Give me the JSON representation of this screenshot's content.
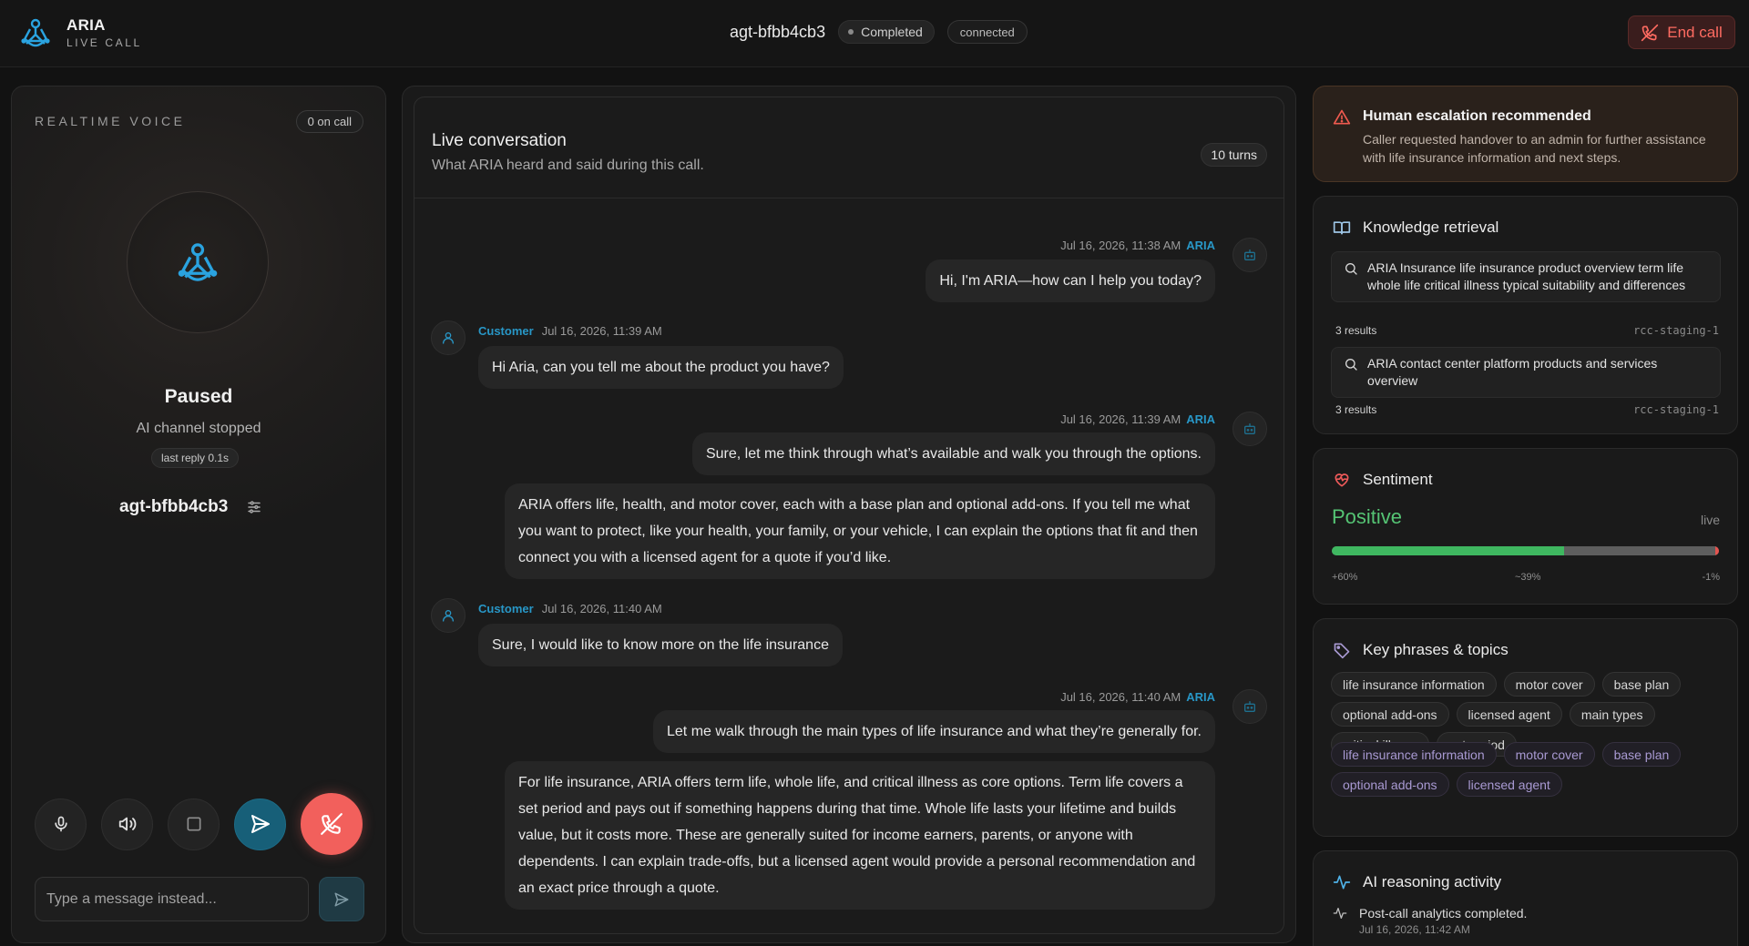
{
  "header": {
    "brand_name": "ARIA",
    "brand_sub": "LIVE CALL",
    "agent_id": "agt-bfbb4cb3",
    "status": "Completed",
    "connection": "connected",
    "end_call_label": "End call"
  },
  "voice": {
    "section_label": "REALTIME VOICE",
    "on_call": "0 on call",
    "state": "Paused",
    "state_detail": "AI channel stopped",
    "last_reply": "last reply 0.1s",
    "agent_id": "agt-bfbb4cb3",
    "input_placeholder": "Type a message instead..."
  },
  "conversation": {
    "title": "Live conversation",
    "subtitle": "What ARIA heard and said during this call.",
    "turns": "10 turns",
    "messages": [
      {
        "who": "ARIA",
        "time": "Jul 16, 2026, 11:38 AM",
        "bubbles": [
          "Hi, I'm ARIA—how can I help you today?"
        ]
      },
      {
        "who": "Customer",
        "time": "Jul 16, 2026, 11:39 AM",
        "bubbles": [
          "Hi Aria, can you tell me about the product you have?"
        ]
      },
      {
        "who": "ARIA",
        "time": "Jul 16, 2026, 11:39 AM",
        "bubbles": [
          "Sure, let me think through what’s available and walk you through the options.",
          "ARIA offers life, health, and motor cover, each with a base plan and optional add-ons. If you tell me what you want to protect, like your health, your family, or your vehicle, I can explain the options that fit and then connect you with a licensed agent for a quote if you’d like."
        ]
      },
      {
        "who": "Customer",
        "time": "Jul 16, 2026, 11:40 AM",
        "bubbles": [
          "Sure, I would like to know more on the life insurance"
        ]
      },
      {
        "who": "ARIA",
        "time": "Jul 16, 2026, 11:40 AM",
        "bubbles": [
          "Let me walk through the main types of life insurance and what they’re generally for.",
          "For life insurance, ARIA offers term life, whole life, and critical illness as core options. Term life covers a set period and pays out if something happens during that time. Whole life lasts your lifetime and builds value, but it costs more. These are generally suited for income earners, parents, or anyone with dependents. I can explain trade-offs, but a licensed agent would provide a personal recommendation and an exact price through a quote."
        ]
      }
    ]
  },
  "escalation": {
    "title": "Human escalation recommended",
    "body": "Caller requested handover to an admin for further assistance with life insurance information and next steps."
  },
  "knowledge": {
    "title": "Knowledge retrieval",
    "queries": [
      {
        "text": "ARIA Insurance life insurance product overview term life whole life critical illness typical suitability and differences",
        "results": "3 results",
        "source": "rcc-staging-1"
      },
      {
        "text": "ARIA contact center platform products and services overview",
        "results": "3 results",
        "source": "rcc-staging-1"
      }
    ]
  },
  "sentiment": {
    "title": "Sentiment",
    "value": "Positive",
    "live": "live",
    "positive_pct": 60,
    "neutral_pct": 39,
    "negative_pct": 1,
    "positive_label": "+60%",
    "neutral_label": "~39%",
    "negative_label": "-1%",
    "colors": {
      "positive": "#3fb760",
      "neutral": "#5e5e5e",
      "negative": "#e4534f"
    }
  },
  "keyphrases": {
    "title": "Key phrases & topics",
    "primary": [
      "life insurance information",
      "motor cover",
      "base plan",
      "optional add-ons",
      "licensed agent",
      "main types",
      "critical illness",
      "set period"
    ],
    "secondary": [
      "life insurance information",
      "motor cover",
      "base plan",
      "optional add-ons",
      "licensed agent"
    ]
  },
  "ai_activity": {
    "title": "AI reasoning activity",
    "entry": "Post-call analytics completed.",
    "time": "Jul 16, 2026, 11:42 AM"
  },
  "icons": {
    "brand": "aria-logo-icon",
    "end_call": "phone-off-icon",
    "mic": "microphone-icon",
    "speaker": "speaker-icon",
    "stop": "stop-icon",
    "send": "send-icon",
    "hangup": "phone-off-icon",
    "settings": "sliders-icon",
    "bot": "bot-icon",
    "user": "user-icon",
    "warning": "warning-triangle-icon",
    "book": "book-icon",
    "search": "search-icon",
    "heart": "heart-pulse-icon",
    "tag": "tag-icon",
    "activity": "activity-icon"
  }
}
